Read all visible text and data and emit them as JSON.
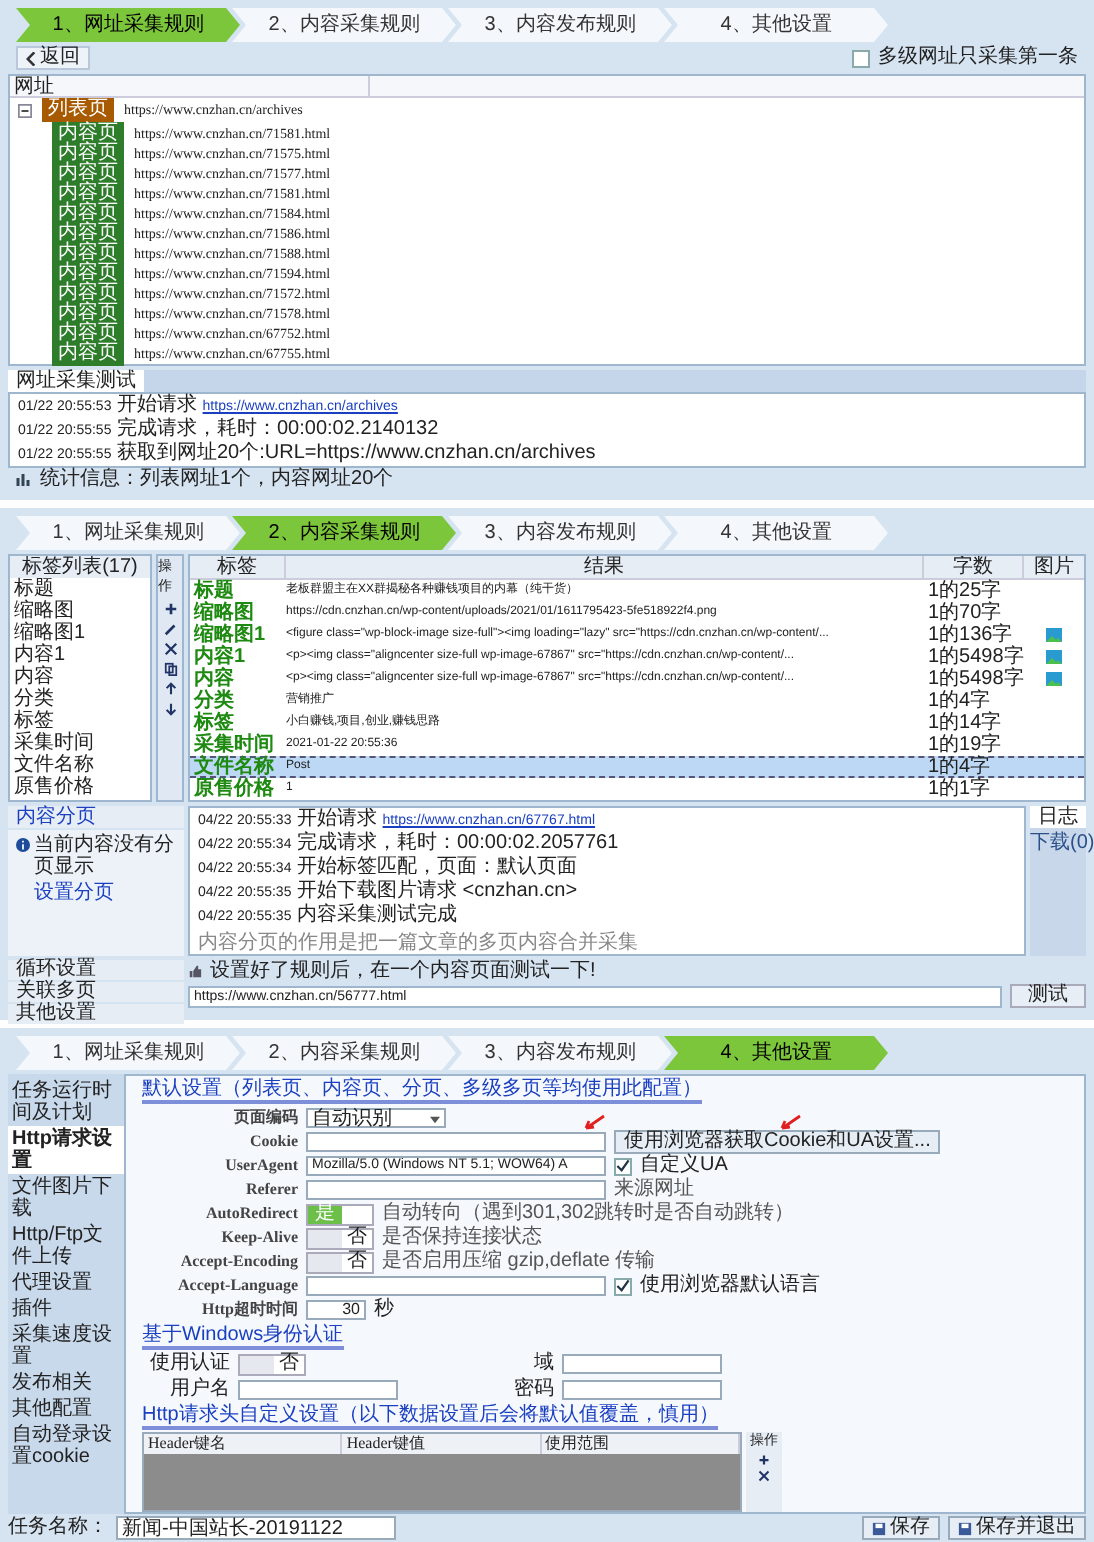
{
  "url_rules": {
    "steps": [
      {
        "label": "1、网址采集规则",
        "selected": true
      },
      {
        "label": "2、内容采集规则",
        "selected": false
      },
      {
        "label": "3、内容发布规则",
        "selected": false
      },
      {
        "label": "4、其他设置",
        "selected": false
      }
    ],
    "back_button": "返回",
    "first_only": {
      "label": "多级网址只采集第一条",
      "checked": false
    },
    "tree_header": "网址",
    "tree": [
      {
        "tag": "列表页",
        "kind": "list",
        "url": "https://www.cnzhan.cn/archives",
        "expanded": true,
        "children": [
          {
            "tag": "内容页",
            "kind": "content",
            "url": "https://www.cnzhan.cn/71581.html"
          },
          {
            "tag": "内容页",
            "kind": "content",
            "url": "https://www.cnzhan.cn/71575.html"
          },
          {
            "tag": "内容页",
            "kind": "content",
            "url": "https://www.cnzhan.cn/71577.html"
          },
          {
            "tag": "内容页",
            "kind": "content",
            "url": "https://www.cnzhan.cn/71581.html"
          },
          {
            "tag": "内容页",
            "kind": "content",
            "url": "https://www.cnzhan.cn/71584.html"
          },
          {
            "tag": "内容页",
            "kind": "content",
            "url": "https://www.cnzhan.cn/71586.html"
          },
          {
            "tag": "内容页",
            "kind": "content",
            "url": "https://www.cnzhan.cn/71588.html"
          },
          {
            "tag": "内容页",
            "kind": "content",
            "url": "https://www.cnzhan.cn/71594.html"
          },
          {
            "tag": "内容页",
            "kind": "content",
            "url": "https://www.cnzhan.cn/71572.html"
          },
          {
            "tag": "内容页",
            "kind": "content",
            "url": "https://www.cnzhan.cn/71578.html"
          },
          {
            "tag": "内容页",
            "kind": "content",
            "url": "https://www.cnzhan.cn/67752.html"
          },
          {
            "tag": "内容页",
            "kind": "content",
            "url": "https://www.cnzhan.cn/67755.html"
          }
        ]
      }
    ],
    "log_tab": "网址采集测试",
    "log": [
      {
        "time": "01/22 20:55:53",
        "text": "开始请求",
        "link": "https://www.cnzhan.cn/archives"
      },
      {
        "time": "01/22 20:55:55",
        "text": "完成请求，耗时：00:00:02.2140132"
      },
      {
        "time": "01/22 20:55:55",
        "text": "获取到网址20个:URL=https://www.cnzhan.cn/archives"
      }
    ],
    "status": "统计信息：列表网址1个，内容网址20个"
  },
  "content_rules": {
    "steps": [
      {
        "label": "1、网址采集规则",
        "selected": false
      },
      {
        "label": "2、内容采集规则",
        "selected": true
      },
      {
        "label": "3、内容发布规则",
        "selected": false
      },
      {
        "label": "4、其他设置",
        "selected": false
      }
    ],
    "tag_list_header": "标签列表(17)",
    "tag_list": [
      "标题",
      "缩略图",
      "缩略图1",
      "内容1",
      "内容",
      "分类",
      "标签",
      "采集时间",
      "文件名称",
      "原售价格"
    ],
    "tools_header": "操作",
    "columns": [
      "标签",
      "结果",
      "字数",
      "图片"
    ],
    "rows": [
      {
        "label": "标题",
        "result": "老板群盟主在XX群揭秘各种赚钱项目的内幕（纯干货）",
        "count": "1的25字",
        "image": false,
        "selected": false
      },
      {
        "label": "缩略图",
        "result": "https://cdn.cnzhan.cn/wp-content/uploads/2021/01/1611795423-5fe518922f4.png",
        "count": "1的70字",
        "image": false,
        "selected": false
      },
      {
        "label": "缩略图1",
        "result": "<figure class=\"wp-block-image size-full\"><img loading=\"lazy\" src=\"https://cdn.cnzhan.cn/wp-content/...",
        "count": "1的136字",
        "image": true,
        "selected": false
      },
      {
        "label": "内容1",
        "result": "<p><img class=\"aligncenter size-full wp-image-67867\" src=\"https://cdn.cnzhan.cn/wp-content/...",
        "count": "1的5498字",
        "image": true,
        "selected": false
      },
      {
        "label": "内容",
        "result": "<p><img class=\"aligncenter size-full wp-image-67867\" src=\"https://cdn.cnzhan.cn/wp-content/...",
        "count": "1的5498字",
        "image": true,
        "selected": false
      },
      {
        "label": "分类",
        "result": "营销推广",
        "count": "1的4字",
        "image": false,
        "selected": false
      },
      {
        "label": "标签",
        "result": "小白赚钱,项目,创业,赚钱思路",
        "count": "1的14字",
        "image": false,
        "selected": false
      },
      {
        "label": "采集时间",
        "result": "2021-01-22 20:55:36",
        "count": "1的19字",
        "image": false,
        "selected": false
      },
      {
        "label": "文件名称",
        "result": "Post",
        "count": "1的4字",
        "image": false,
        "selected": true
      },
      {
        "label": "原售价格",
        "result": "1",
        "count": "1的1字",
        "image": false,
        "selected": false
      }
    ],
    "paging_section": "内容分页",
    "paging_info": "当前内容没有分页显示",
    "paging_link": "设置分页",
    "paging_note": "内容分页的作用是把一篇文章的多页内容合并采集",
    "accordion": [
      "循环设置",
      "关联多页",
      "其他设置"
    ],
    "log": [
      {
        "time": "04/22 20:55:33",
        "text": "开始请求",
        "link": "https://www.cnzhan.cn/67767.html"
      },
      {
        "time": "04/22 20:55:34",
        "text": "完成请求，耗时：00:00:02.2057761"
      },
      {
        "time": "04/22 20:55:34",
        "text": "开始标签匹配，页面：默认页面"
      },
      {
        "time": "04/22 20:55:35",
        "text": "开始下载图片请求 <cnzhan.cn>"
      },
      {
        "time": "04/22 20:55:35",
        "text": "内容采集测试完成"
      }
    ],
    "side_tabs": [
      {
        "label": "日志",
        "selected": true
      },
      {
        "label": "下载(0)",
        "selected": false
      }
    ],
    "hint": "设置好了规则后，在一个内容页面测试一下!",
    "test_url": "https://www.cnzhan.cn/56777.html",
    "test_button": "测试"
  },
  "other_settings": {
    "steps": [
      {
        "label": "1、网址采集规则",
        "selected": false
      },
      {
        "label": "2、内容采集规则",
        "selected": false
      },
      {
        "label": "3、内容发布规则",
        "selected": false
      },
      {
        "label": "4、其他设置",
        "selected": true
      }
    ],
    "sidebar": [
      {
        "label": "任务运行时间及计划",
        "selected": false
      },
      {
        "label": "Http请求设置",
        "selected": true
      },
      {
        "label": "文件图片下载",
        "selected": false
      },
      {
        "label": "Http/Ftp文件上传",
        "selected": false
      },
      {
        "label": "代理设置",
        "selected": false
      },
      {
        "label": "插件",
        "selected": false
      },
      {
        "label": "采集速度设置",
        "selected": false
      },
      {
        "label": "发布相关",
        "selected": false
      },
      {
        "label": "其他配置",
        "selected": false
      },
      {
        "label": "自动登录设置cookie",
        "selected": false
      }
    ],
    "default_heading": "默认设置（列表页、内容页、分页、多级多页等均使用此配置）",
    "fields": [
      {
        "kind": "select",
        "label": "页面编码",
        "value": "自动识别"
      },
      {
        "kind": "input",
        "label": "Cookie",
        "button": "使用浏览器获取Cookie和UA设置..."
      },
      {
        "kind": "input",
        "label": "UserAgent",
        "value": "Mozilla/5.0 (Windows NT 5.1; WOW64) A",
        "check": {
          "label": "自定义UA",
          "checked": true
        }
      },
      {
        "kind": "input",
        "label": "Referer",
        "note": "来源网址"
      },
      {
        "kind": "toggle",
        "label": "AutoRedirect",
        "on": true,
        "text": "是",
        "note": "自动转向（遇到301,302跳转时是否自动跳转）"
      },
      {
        "kind": "toggle",
        "label": "Keep-Alive",
        "on": false,
        "text": "否",
        "note": "是否保持连接状态"
      },
      {
        "kind": "toggle",
        "label": "Accept-Encoding",
        "on": false,
        "text": "否",
        "note": "是否启用压缩 gzip,deflate 传输"
      },
      {
        "kind": "input",
        "label": "Accept-Language",
        "check": {
          "label": "使用浏览器默认语言",
          "checked": true
        }
      },
      {
        "kind": "spinner",
        "label": "Http超时时间",
        "value": "30",
        "unit": "秒"
      }
    ],
    "auth_heading": "基于Windows身份认证",
    "auth_toggle": {
      "label": "使用认证",
      "on": false,
      "text": "否"
    },
    "auth_fields": [
      {
        "label": "域"
      },
      {
        "label": "用户名"
      },
      {
        "label": "密码"
      }
    ],
    "header_heading": "Http请求头自定义设置（以下数据设置后会将默认值覆盖，慎用）",
    "header_columns": [
      "Header键名",
      "Header键值",
      "使用范围"
    ],
    "header_tools_label": "操作",
    "task_name_label": "任务名称：",
    "task_name": "新闻-中国站长-20191122",
    "buttons": [
      "保存",
      "保存并退出"
    ]
  }
}
